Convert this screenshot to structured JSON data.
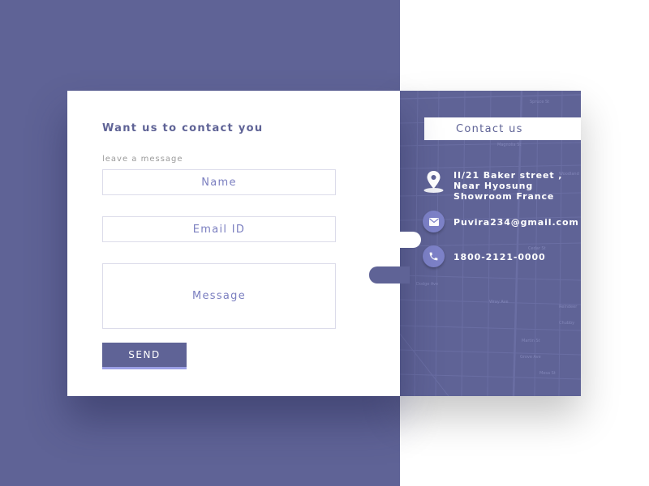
{
  "form": {
    "title": "Want us to contact you",
    "subtitle": "leave a message",
    "name_placeholder": "Name",
    "email_placeholder": "Email ID",
    "message_placeholder": "Message",
    "send_label": "SEND"
  },
  "contact": {
    "heading": "Contact us",
    "address": "II/21 Baker street ,\nNear Hyosung\nShowroom France",
    "email": "Puvira234@gmail.com",
    "phone": "1800-2121-0000",
    "icons": [
      "location-pin-icon",
      "mail-icon",
      "phone-icon"
    ]
  },
  "colors": {
    "accent": "#5f6396",
    "field_text": "#7b7fc0",
    "icon_circle": "#7d82c8",
    "button_underline": "#9b9fe6"
  }
}
